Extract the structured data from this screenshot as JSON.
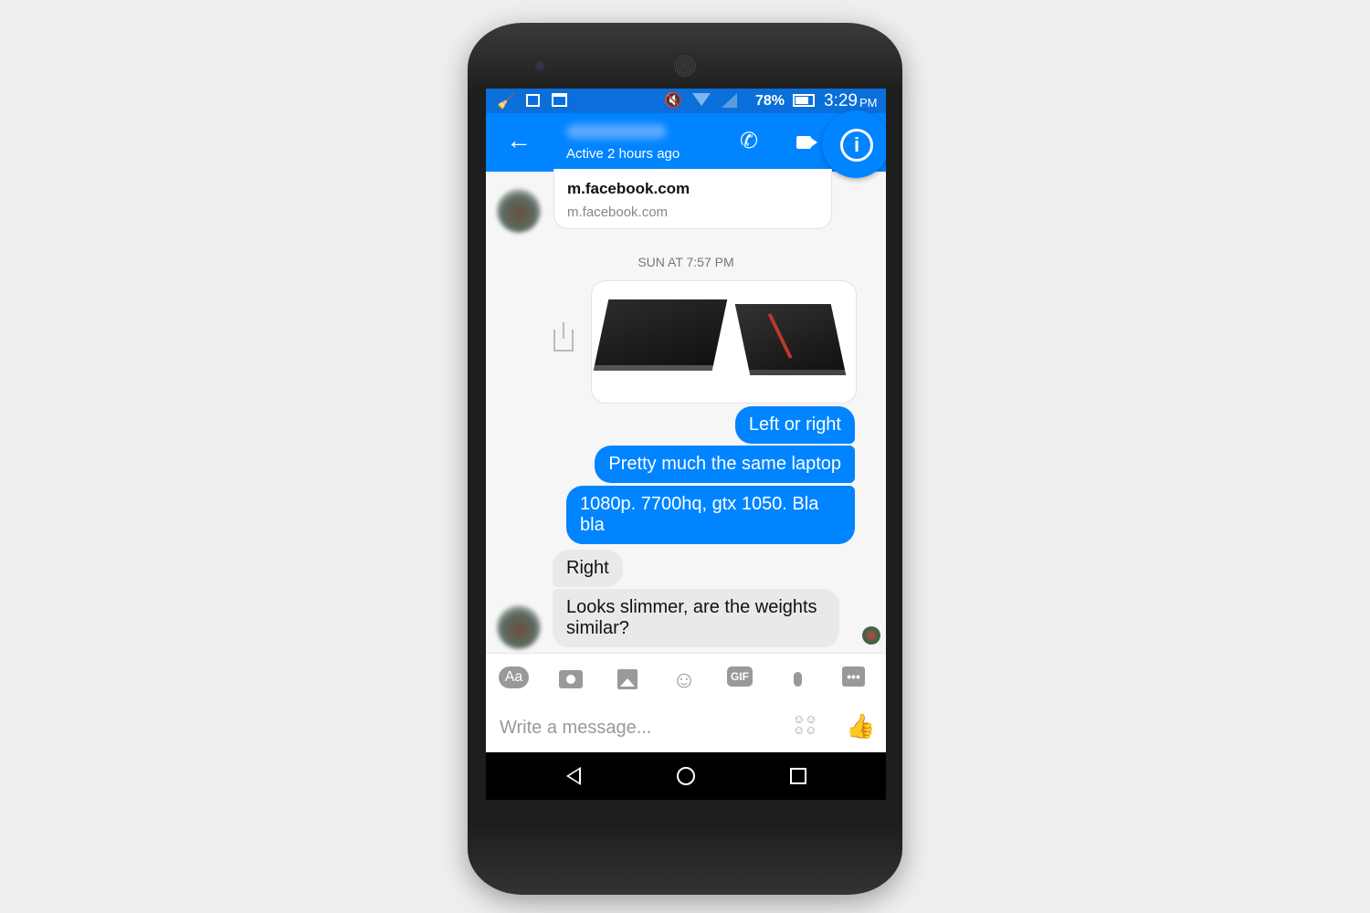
{
  "status_bar": {
    "battery": "78%",
    "time": "3:29",
    "ampm": "PM"
  },
  "header": {
    "subtitle": "Active 2 hours ago"
  },
  "link_preview": {
    "title": "m.facebook.com",
    "domain": "m.facebook.com"
  },
  "timestamp": "SUN AT 7:57 PM",
  "messages": [
    {
      "from": "me",
      "text": "Left or right"
    },
    {
      "from": "me",
      "text": "Pretty much the same laptop"
    },
    {
      "from": "me",
      "text": "1080p. 7700hq, gtx 1050. Bla bla"
    },
    {
      "from": "them",
      "text": "Right"
    },
    {
      "from": "them",
      "text": "Looks slimmer, are the weights similar?"
    }
  ],
  "composer": {
    "placeholder": "Write a message...",
    "tools": [
      "text-format-icon",
      "camera-icon",
      "image-icon",
      "emoji-icon",
      "gif-icon",
      "microphone-icon",
      "more-icon"
    ],
    "gif_label": "GIF",
    "aa_label": "Aa"
  },
  "colors": {
    "accent": "#0084ff",
    "status_bar": "#0a6fdb"
  }
}
